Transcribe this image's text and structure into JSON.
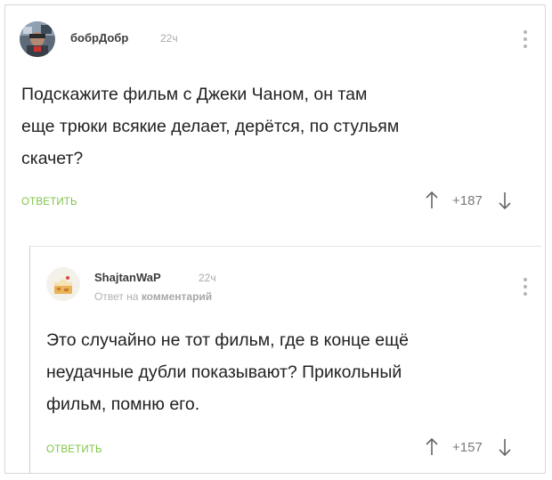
{
  "comment": {
    "author": "бобрДобр",
    "time": "22ч",
    "text_lines": [
      "Подскажите фильм с Джеки Чаном, он там",
      "еще трюки всякие делает, дерётся, по стульям",
      "скачет?"
    ],
    "reply_label": "ОТВЕТИТЬ",
    "score": "+187",
    "avatar_icon": "user-photo-avatar",
    "menu_icon": "more-vertical-icon"
  },
  "reply": {
    "author": "ShajtanWaP",
    "time": "22ч",
    "sub_prefix": "Ответ на",
    "sub_link": "комментарий",
    "text_lines": [
      "Это случайно не тот фильм, где в конце ещё",
      "неудачные дубли показывают? Прикольный",
      "фильм, помню его."
    ],
    "reply_label": "ОТВЕТИТЬ",
    "score": "+157",
    "avatar_icon": "cake-avatar",
    "menu_icon": "more-vertical-icon"
  },
  "colors": {
    "accent_green": "#7fc447",
    "muted_text": "#a9a9a9",
    "body_text": "#222222"
  }
}
